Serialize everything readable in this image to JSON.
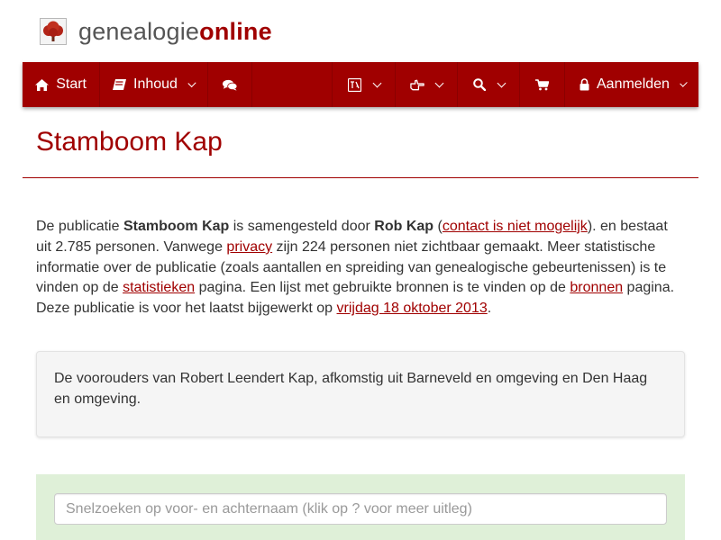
{
  "brand": {
    "name_part1": "genealogie",
    "name_part2": "online",
    "accent_color": "#a00000"
  },
  "navbar": {
    "background_color": "#a00000",
    "items": [
      {
        "label": "Start",
        "icon": "home-icon",
        "has_dropdown": false
      },
      {
        "label": "Inhoud",
        "icon": "book-icon",
        "has_dropdown": true
      },
      {
        "label": "",
        "icon": "chat-bubbles-icon",
        "has_dropdown": false
      },
      {
        "label": "",
        "icon": "translate-icon",
        "has_dropdown": true
      },
      {
        "label": "",
        "icon": "hand-pointing-icon",
        "has_dropdown": true
      },
      {
        "label": "",
        "icon": "search-icon",
        "has_dropdown": true
      },
      {
        "label": "",
        "icon": "shopping-cart-icon",
        "has_dropdown": false
      },
      {
        "label": "Aanmelden",
        "icon": "lock-icon",
        "has_dropdown": true
      }
    ]
  },
  "page": {
    "title": "Stamboom Kap"
  },
  "intro": {
    "t1": "De publicatie ",
    "publication_name": "Stamboom Kap",
    "t2": " is samengesteld door ",
    "author": "Rob Kap",
    "t3": " (",
    "contact_link": "contact is niet mogelijk",
    "t4": "). en bestaat uit 2.785 personen. Vanwege ",
    "privacy_link": "privacy",
    "t5": " zijn 224 personen niet zichtbaar gemaakt. Meer statistische informatie over de publicatie (zoals aantallen en spreiding van genealogische gebeurtenissen) is te vinden op de ",
    "stats_link": "statistieken",
    "t6": " pagina. Een lijst met gebruikte bronnen is te vinden op de ",
    "sources_link": "bronnen",
    "t7": " pagina. Deze publicatie is voor het laatst bijgewerkt op ",
    "date_link": "vrijdag 18 oktober 2013",
    "t8": "."
  },
  "description": {
    "text": "De voorouders van Robert Leendert Kap, afkomstig uit Barneveld en omgeving en Den Haag en omgeving."
  },
  "search": {
    "placeholder": "Snelzoeken op voor- en achternaam (klik op ? voor meer uitleg)",
    "value": "",
    "panel_color": "#dff0d8"
  }
}
